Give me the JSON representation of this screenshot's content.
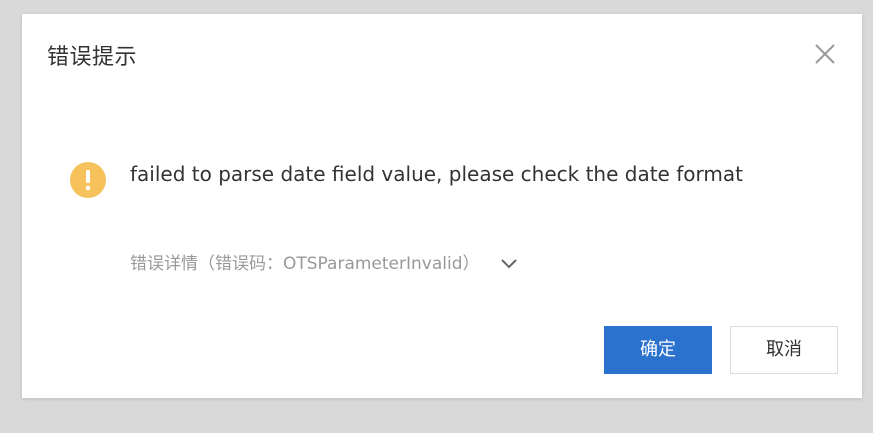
{
  "dialog": {
    "title": "错误提示",
    "message": "failed to parse date field value, please check the date format",
    "detail_label": "错误详情（错误码：OTSParameterInvalid）",
    "confirm_label": "确定",
    "cancel_label": "取消",
    "icons": {
      "close": "close-icon",
      "warning": "warning-icon",
      "expand": "chevron-down-icon"
    }
  },
  "colors": {
    "primary": "#2b72cf",
    "warning": "#f7c15c",
    "backdrop": "#d9d9d9",
    "muted_text": "#999999",
    "text": "#333333"
  }
}
